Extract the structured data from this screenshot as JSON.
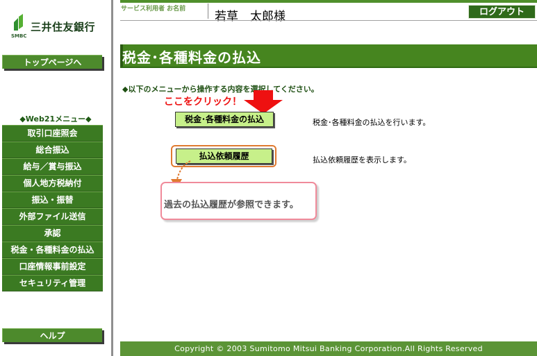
{
  "bank": {
    "name": "三井住友銀行",
    "sub": "SMBC"
  },
  "sidebar": {
    "top_button": "トップページへ",
    "menu_title": "◆Web21メニュー◆",
    "items": [
      "取引口座照会",
      "総合振込",
      "給与／賞与振込",
      "個人地方税納付",
      "振込・振替",
      "外部ファイル送信",
      "承認",
      "税金・各種料金の払込",
      "口座情報事前設定",
      "セキュリティ管理"
    ],
    "help_button": "ヘルプ"
  },
  "header": {
    "user_label": "サービス利用者 お名前",
    "user_name": "若草　太郎様",
    "logout": "ログアウト"
  },
  "main": {
    "title": "税金･各種料金の払込",
    "instruction": "◆以下のメニューから操作する内容を選択してください。",
    "click_here": "ここをクリック！",
    "buttons": [
      {
        "label": "税金･各種料金の払込",
        "desc": "税金･各種料金の払込を行います。"
      },
      {
        "label": "払込依頼履歴",
        "desc": "払込依頼履歴を表示します。"
      }
    ],
    "callout": "過去の払込履歴が参照できます。"
  },
  "footer": {
    "text": "Copyright © 2003 Sumitomo Mitsui Banking Corporation.All Rights Reserved"
  },
  "colors": {
    "brand_green": "#46851f",
    "button_green": "#c7f08a",
    "accent_red": "#ee1111",
    "callout_border": "#f08a9a"
  }
}
